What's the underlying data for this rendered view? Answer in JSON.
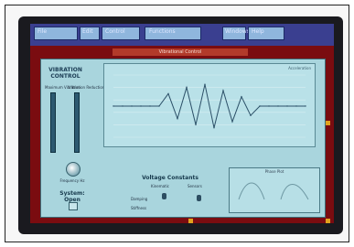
{
  "menubar": {
    "items": [
      "File",
      "Edit",
      "Control",
      "Functions",
      "Windows",
      "Help"
    ]
  },
  "window_title": "Vibrational Control",
  "panel": {
    "title": "VIBRATION CONTROL",
    "slider_labels": [
      "Maximum Vibration",
      "Vibration Reduction"
    ],
    "chart_label": "Acceleration",
    "knob_label": "Frequency Hz",
    "status": "System: Open",
    "coefficients_title": "Voltage Constants",
    "coef_labels": [
      "Kinematic",
      "Sensors",
      "Damping",
      "Stiffness"
    ],
    "mini_label": "Phase Plot"
  },
  "colors": {
    "screen_bg": "#7a0c10",
    "panel_bg": "#a9d5dd",
    "menubar_bg": "#3a3f90",
    "accent": "#e2a21e"
  },
  "chart_data": {
    "type": "line",
    "title": "",
    "xlabel": "",
    "ylabel": "",
    "series": [
      {
        "values": [
          0,
          0,
          0,
          0,
          0,
          0,
          8,
          -8,
          12,
          -12,
          14,
          -14,
          10,
          -10,
          6,
          -6,
          0,
          0,
          0,
          0,
          0,
          0
        ]
      }
    ],
    "ylim": [
      -20,
      20
    ]
  }
}
